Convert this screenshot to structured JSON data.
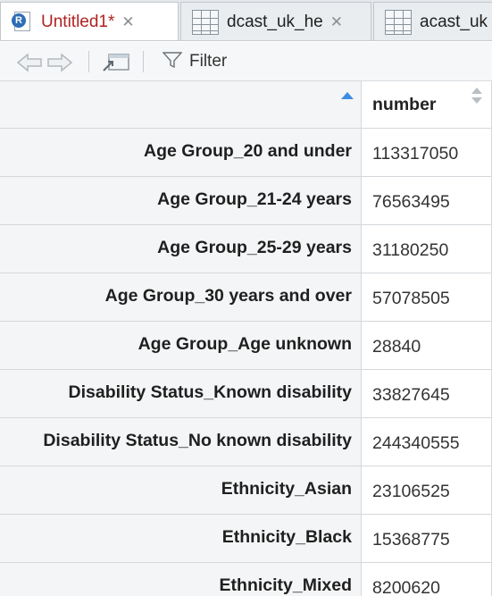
{
  "tabs": [
    {
      "label": "Untitled1*",
      "close": "✕",
      "icon": "r-script-icon"
    },
    {
      "label": "dcast_uk_he",
      "close": "✕",
      "icon": "table-grid-icon"
    },
    {
      "label": "acast_uk",
      "close": "",
      "icon": "table-grid-icon"
    }
  ],
  "toolbar": {
    "filter_label": "Filter"
  },
  "table": {
    "column_header": "number",
    "rows": [
      {
        "name": "Age Group_20 and under",
        "value": "113317050"
      },
      {
        "name": "Age Group_21-24 years",
        "value": "76563495"
      },
      {
        "name": "Age Group_25-29 years",
        "value": "31180250"
      },
      {
        "name": "Age Group_30 years and over",
        "value": "57078505"
      },
      {
        "name": "Age Group_Age unknown",
        "value": "28840"
      },
      {
        "name": "Disability Status_Known disability",
        "value": "33827645"
      },
      {
        "name": "Disability Status_No known disability",
        "value": "244340555"
      },
      {
        "name": "Ethnicity_Asian",
        "value": "23106525"
      },
      {
        "name": "Ethnicity_Black",
        "value": "15368775"
      },
      {
        "name": "Ethnicity_Mixed",
        "value": "8200620"
      }
    ]
  },
  "colors": {
    "modified_tab": "#b22222",
    "sort_active": "#3d8ee0"
  }
}
